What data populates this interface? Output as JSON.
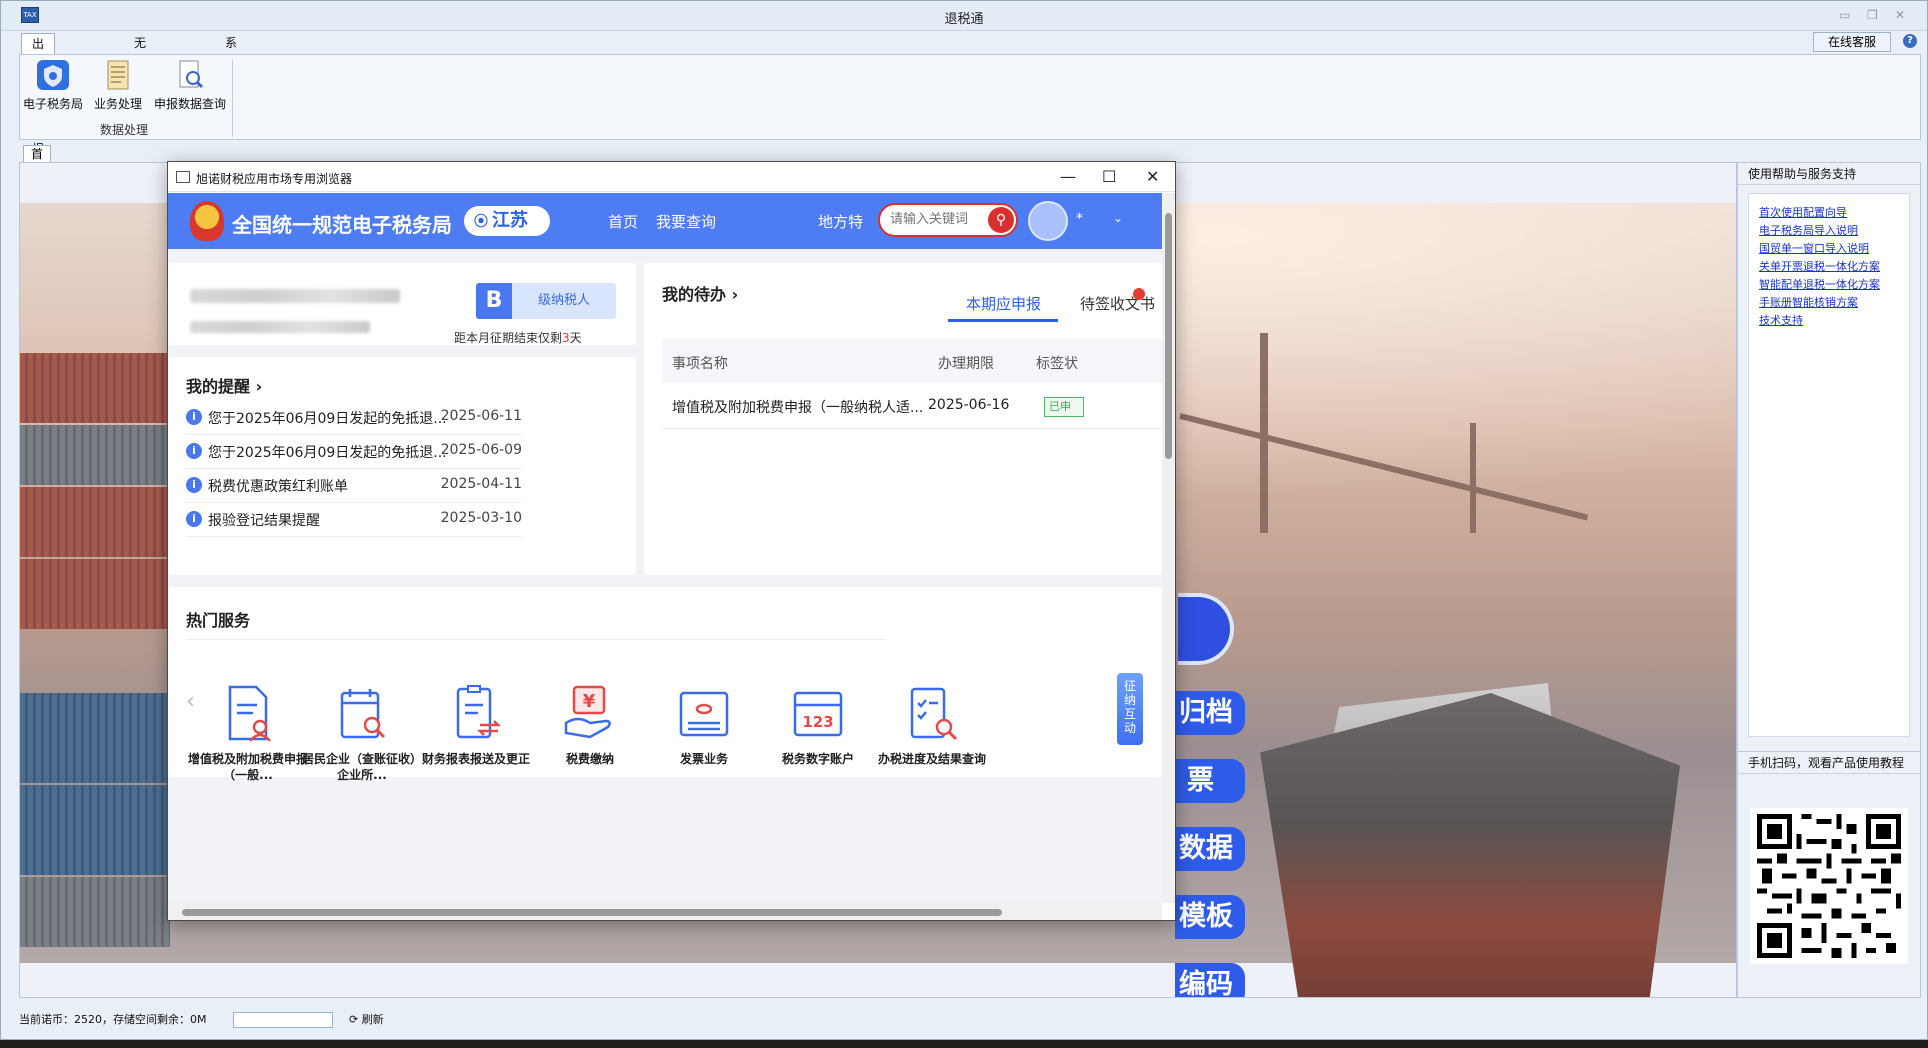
{
  "app": {
    "title": "退税通",
    "icon_text": "TAX",
    "tabs": [
      "出口退税申报",
      "无纸化备案",
      "系统维护"
    ],
    "online_service": "在线客服",
    "ribbon": {
      "buttons": [
        "电子税务局",
        "业务处理",
        "申报数据查询"
      ],
      "group_label": "数据处理"
    },
    "doc_tab": "首页",
    "help_panel": {
      "title": "使用帮助与服务支持",
      "links": [
        "首次使用配置向导",
        "电子税务局导入说明",
        "国贸单一窗口导入说明",
        "关单开票退税一体化方案",
        "智能配单退税一体化方案",
        "手账册智能核销方案",
        "技术支持"
      ]
    },
    "qr_panel": {
      "title": "手机扫码，观看产品使用教程"
    },
    "side_buttons": [
      "归档",
      "票",
      "数据",
      "模板",
      "编码"
    ],
    "statusbar": {
      "text": "当前诺币：2520，存储空间剩余：0M",
      "refresh": "刷新"
    }
  },
  "browser": {
    "title": "旭诺财税应用市场专用浏览器",
    "site_name": "全国统一规范电子税务局",
    "region": "江苏",
    "nav": [
      "首页",
      "我要查询"
    ],
    "local_feature": "地方特",
    "search_placeholder": "请输入关键词",
    "user_name": "*",
    "taxpayer": {
      "grade_letter": "B",
      "type": "级纳税人",
      "deadline_prefix": "距本月征期结束仅剩",
      "deadline_days": "3",
      "deadline_suffix": "天"
    },
    "reminders": {
      "title": "我的提醒 ›",
      "items": [
        {
          "text": "您于2025年06月09日发起的免抵退...",
          "date": "2025-06-11"
        },
        {
          "text": "您于2025年06月09日发起的免抵退...",
          "date": "2025-06-09"
        },
        {
          "text": "税费优惠政策红利账单",
          "date": "2025-04-11"
        },
        {
          "text": "报验登记结果提醒",
          "date": "2025-03-10"
        }
      ]
    },
    "todo": {
      "title": "我的待办 ›",
      "tabs": [
        "本期应申报",
        "待签收文书"
      ],
      "columns": [
        "事项名称",
        "办理期限",
        "标签状"
      ],
      "rows": [
        {
          "name": "增值税及附加税费申报（一般纳税人适...",
          "deadline": "2025-06-16",
          "status": "已申"
        }
      ]
    },
    "hot_services": {
      "title": "热门服务",
      "items": [
        "增值税及附加税费申报（一般...",
        "居民企业（查账征收）企业所...",
        "财务报表报送及更正",
        "税费缴纳",
        "发票业务",
        "税务数字账户",
        "办税进度及结果查询"
      ]
    },
    "float_tab": "征纳互动"
  },
  "colors": {
    "brand_blue": "#4d7cf3",
    "link_blue": "#1b34c9",
    "alert_red": "#e23b2e"
  }
}
